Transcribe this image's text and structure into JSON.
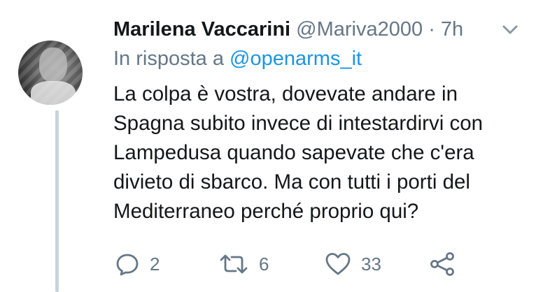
{
  "tweet": {
    "author_name": "Marilena Vaccarini",
    "author_handle": "@Mariva2000",
    "separator": "·",
    "time": "7h",
    "reply_prefix": "In risposta a",
    "reply_to": "@openarms_it",
    "text_lines": [
      "La colpa è vostra, dovevate andare in",
      "Spagna subito invece di intestardirvi con",
      "Lampedusa quando sapevate che c'era",
      "divieto di sbarco. Ma con tutti i porti del",
      "Mediterraneo perché proprio qui?"
    ]
  },
  "actions": {
    "reply_count": "2",
    "retweet_count": "6",
    "like_count": "33"
  },
  "colors": {
    "text_primary": "#14171a",
    "text_secondary": "#657786",
    "link": "#1b95e0",
    "thread_line": "#c9d3db"
  },
  "icons": [
    "chevron-down-icon",
    "reply-icon",
    "retweet-icon",
    "like-icon",
    "share-icon"
  ]
}
